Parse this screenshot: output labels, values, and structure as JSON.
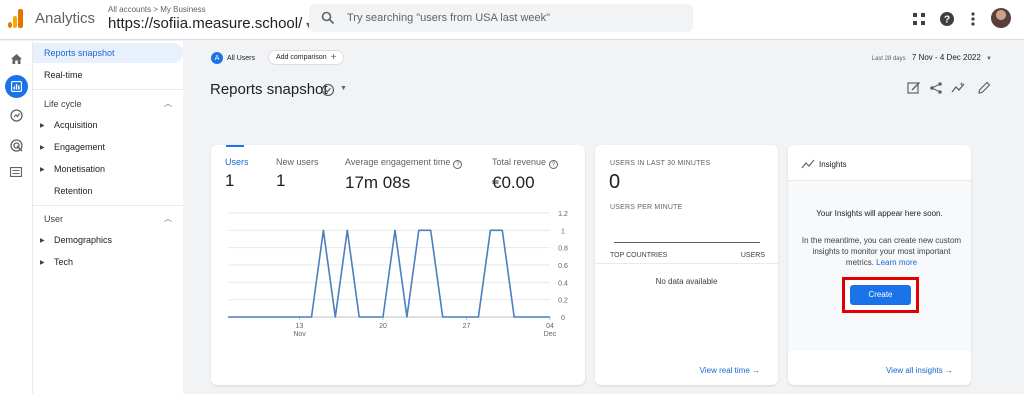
{
  "topbar": {
    "app_name": "Analytics",
    "breadcrumb": "All accounts > My Business",
    "property": "https://sofiia.measure.school/",
    "search_placeholder": "Try searching \"users from USA last week\""
  },
  "nav": {
    "items": [
      {
        "label": "Reports snapshot",
        "active": true
      },
      {
        "label": "Real-time"
      }
    ],
    "sections": [
      {
        "label": "Life cycle",
        "items": [
          "Acquisition",
          "Engagement",
          "Monetisation",
          "Retention"
        ]
      },
      {
        "label": "User",
        "items": [
          "Demographics",
          "Tech"
        ]
      }
    ]
  },
  "main": {
    "all_users": "All Users",
    "all_users_letter": "A",
    "add_comparison": "Add comparison",
    "date_label": "Last 28 days",
    "date_range": "7 Nov - 4 Dec 2022",
    "page_title": "Reports snapshot"
  },
  "overview": {
    "metrics": [
      {
        "label": "Users",
        "value": "1",
        "selected": true
      },
      {
        "label": "New users",
        "value": "1"
      },
      {
        "label": "Average engagement time",
        "value": "17m 08s",
        "info": true
      },
      {
        "label": "Total revenue",
        "value": "€0.00",
        "info": true
      }
    ]
  },
  "chart_data": {
    "type": "line",
    "y_ticks": [
      "1.2",
      "1",
      "0.8",
      "0.6",
      "0.4",
      "0.2",
      "0"
    ],
    "x_ticks": [
      {
        "day": "13",
        "month": "Nov"
      },
      {
        "day": "20",
        "month": ""
      },
      {
        "day": "27",
        "month": ""
      },
      {
        "day": "04",
        "month": "Dec"
      }
    ],
    "ylim": [
      0,
      1.2
    ],
    "x": [
      "7 Nov",
      "8 Nov",
      "9 Nov",
      "10 Nov",
      "11 Nov",
      "12 Nov",
      "13 Nov",
      "14 Nov",
      "15 Nov",
      "16 Nov",
      "17 Nov",
      "18 Nov",
      "19 Nov",
      "20 Nov",
      "21 Nov",
      "22 Nov",
      "23 Nov",
      "24 Nov",
      "25 Nov",
      "26 Nov",
      "27 Nov",
      "28 Nov",
      "29 Nov",
      "30 Nov",
      "1 Dec",
      "2 Dec",
      "3 Dec",
      "4 Dec"
    ],
    "series": [
      {
        "values": [
          0,
          0,
          0,
          0,
          0,
          0,
          0,
          0,
          1,
          0,
          1,
          0,
          0,
          0,
          1,
          0,
          1,
          1,
          0,
          0,
          0,
          0,
          1,
          1,
          0,
          0,
          0,
          0
        ],
        "color": "#4a7fc1"
      }
    ],
    "grid": true
  },
  "realtime": {
    "users_label": "USERS IN LAST 30 MINUTES",
    "users_value": "0",
    "per_minute_label": "USERS PER MINUTE",
    "countries_label": "TOP COUNTRIES",
    "users_col": "USERS",
    "no_data": "No data available",
    "link": "View real time"
  },
  "insights": {
    "title": "Insights",
    "heading": "Your Insights will appear here soon.",
    "body": "In the meantime, you can create new custom insights to monitor your most important metrics.",
    "learn_more": "Learn more",
    "create": "Create",
    "link": "View all insights"
  },
  "colors": {
    "accent": "#1a73e8",
    "highlight": "#e00000"
  }
}
